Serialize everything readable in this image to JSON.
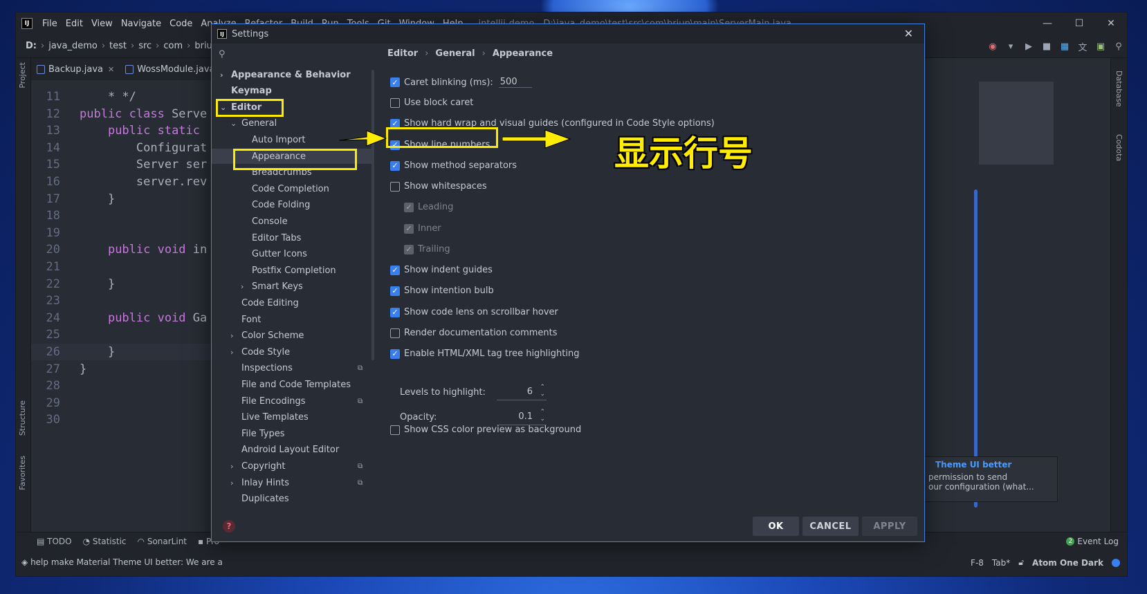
{
  "ide": {
    "logo": "IJ",
    "menu": [
      "File",
      "Edit",
      "View",
      "Navigate",
      "Code",
      "Analyze",
      "Refactor",
      "Build",
      "Run",
      "Tools",
      "Git",
      "Window",
      "Help"
    ],
    "title_path": "intellij-demo - D:\\java_demo\\test\\src\\com\\briup\\main\\ServerMain.java",
    "window_controls": [
      "—",
      "☐",
      "✕"
    ],
    "breadcrumbs": [
      "D:",
      "java_demo",
      "test",
      "src",
      "com",
      "briup"
    ],
    "left_strip": {
      "project": "Project",
      "structure": "Structure",
      "favorites": "Favorites"
    },
    "right_strip": {
      "database": "Database",
      "codota": "Codota"
    },
    "tabs": [
      {
        "name": "Backup.java"
      },
      {
        "name": "WossModule.java"
      }
    ],
    "code_lines": [
      {
        "num": "11",
        "pre": "    * */",
        "kw": "",
        "post": ""
      },
      {
        "num": "12",
        "pre": "",
        "kw": "public class",
        "post": " Serve"
      },
      {
        "num": "13",
        "pre": "    ",
        "kw": "public static",
        "post": ""
      },
      {
        "num": "14",
        "pre": "        Configurat",
        "kw": "",
        "post": ""
      },
      {
        "num": "15",
        "pre": "        Server ser",
        "kw": "",
        "post": ""
      },
      {
        "num": "16",
        "pre": "        server.rev",
        "kw": "",
        "post": ""
      },
      {
        "num": "17",
        "pre": "    }",
        "kw": "",
        "post": ""
      },
      {
        "num": "18",
        "pre": "",
        "kw": "",
        "post": ""
      },
      {
        "num": "19",
        "pre": "",
        "kw": "",
        "post": ""
      },
      {
        "num": "20",
        "pre": "    ",
        "kw": "public void",
        "post": " in"
      },
      {
        "num": "21",
        "pre": "",
        "kw": "",
        "post": ""
      },
      {
        "num": "22",
        "pre": "    }",
        "kw": "",
        "post": ""
      },
      {
        "num": "23",
        "pre": "",
        "kw": "",
        "post": ""
      },
      {
        "num": "24",
        "pre": "    ",
        "kw": "public void",
        "post": " Ga"
      },
      {
        "num": "25",
        "pre": "",
        "kw": "",
        "post": ""
      },
      {
        "num": "26",
        "pre": "    }",
        "kw": "",
        "post": ""
      },
      {
        "num": "27",
        "pre": "}",
        "kw": "",
        "post": ""
      },
      {
        "num": "28",
        "pre": "",
        "kw": "",
        "post": ""
      },
      {
        "num": "29",
        "pre": "",
        "kw": "",
        "post": ""
      },
      {
        "num": "30",
        "pre": "",
        "kw": "",
        "post": ""
      }
    ],
    "tool_tabs": [
      "TODO",
      "Statistic",
      "SonarLint",
      "Pro"
    ],
    "event_log": "Event Log",
    "event_log_count": "2",
    "status_message": "help make Material Theme UI better: We are a",
    "status_right": [
      "F-8",
      "Tab*",
      "Atom One Dark"
    ],
    "notification": {
      "title": "Theme UI better",
      "line1": "permission to send",
      "line2": "our configuration (what..."
    }
  },
  "settings": {
    "title": "Settings",
    "search_placeholder": "",
    "tree": [
      {
        "label": "Appearance & Behavior",
        "chev": "›",
        "bold": true
      },
      {
        "label": "Keymap",
        "chev": "",
        "bold": true
      },
      {
        "label": "Editor",
        "chev": "⌄",
        "bold": true
      },
      {
        "label": "General",
        "chev": "⌄"
      },
      {
        "label": "Auto Import"
      },
      {
        "label": "Appearance"
      },
      {
        "label": "Breadcrumbs"
      },
      {
        "label": "Code Completion"
      },
      {
        "label": "Code Folding"
      },
      {
        "label": "Console"
      },
      {
        "label": "Editor Tabs"
      },
      {
        "label": "Gutter Icons"
      },
      {
        "label": "Postfix Completion"
      },
      {
        "label": "Smart Keys",
        "chev": "›"
      },
      {
        "label": "Code Editing"
      },
      {
        "label": "Font"
      },
      {
        "label": "Color Scheme",
        "chev": "›"
      },
      {
        "label": "Code Style",
        "chev": "›"
      },
      {
        "label": "Inspections"
      },
      {
        "label": "File and Code Templates"
      },
      {
        "label": "File Encodings"
      },
      {
        "label": "Live Templates"
      },
      {
        "label": "File Types"
      },
      {
        "label": "Android Layout Editor"
      },
      {
        "label": "Copyright",
        "chev": "›"
      },
      {
        "label": "Inlay Hints",
        "chev": "›"
      },
      {
        "label": "Duplicates"
      }
    ],
    "breadcrumb": [
      "Editor",
      "General",
      "Appearance"
    ],
    "breadcrumb_sep": "›",
    "options": {
      "caret_blinking": {
        "label": "Caret blinking (ms):",
        "checked": true,
        "value": "500"
      },
      "block_caret": {
        "label": "Use block caret",
        "checked": false
      },
      "hard_wrap": {
        "label": "Show hard wrap and visual guides (configured in Code Style options)",
        "checked": true
      },
      "line_numbers": {
        "label": "Show line numbers",
        "checked": true
      },
      "method_separators": {
        "label": "Show method separators",
        "checked": true
      },
      "whitespaces": {
        "label": "Show whitespaces",
        "checked": false
      },
      "leading": {
        "label": "Leading",
        "checked": true,
        "disabled": true
      },
      "inner": {
        "label": "Inner",
        "checked": true,
        "disabled": true
      },
      "trailing": {
        "label": "Trailing",
        "checked": true,
        "disabled": true
      },
      "indent_guides": {
        "label": "Show indent guides",
        "checked": true
      },
      "intention_bulb": {
        "label": "Show intention bulb",
        "checked": true
      },
      "code_lens": {
        "label": "Show code lens on scrollbar hover",
        "checked": true
      },
      "render_docs": {
        "label": "Render documentation comments",
        "checked": false
      },
      "tag_tree": {
        "label": "Enable HTML/XML tag tree highlighting",
        "checked": true
      },
      "css_preview": {
        "label": "Show CSS color preview as background",
        "checked": false
      }
    },
    "levels": {
      "label": "Levels to highlight:",
      "value": "6"
    },
    "opacity": {
      "label": "Opacity:",
      "value": "0.1"
    },
    "buttons": {
      "ok": "OK",
      "cancel": "CANCEL",
      "apply": "APPLY"
    },
    "help": "?"
  },
  "annotation": {
    "text": "显示行号",
    "color": "#ffec00"
  },
  "colors": {
    "accent": "#3a7ff0",
    "highlight": "#ffec00",
    "keyword": "#c678dd"
  }
}
